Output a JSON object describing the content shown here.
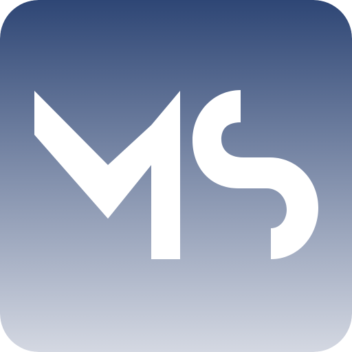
{
  "icon": {
    "name": "app-icon",
    "monogram": "MS",
    "colors": {
      "gradient_top": "#2e4675",
      "gradient_bottom": "#d4d8e2",
      "glyph": "#ffffff"
    }
  }
}
